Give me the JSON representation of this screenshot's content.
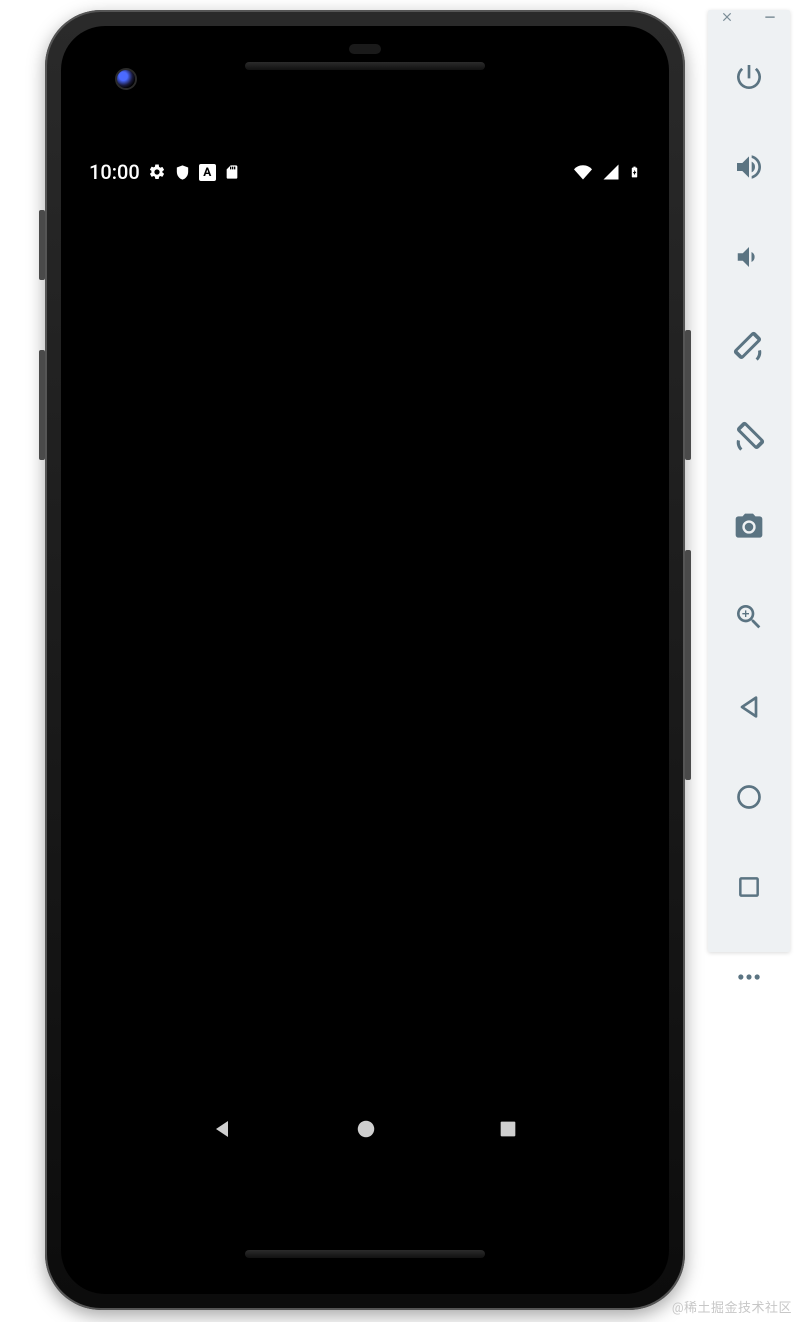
{
  "status_bar": {
    "time": "10:00",
    "left_icons": [
      "settings-icon",
      "shield-icon",
      "badge-a-icon",
      "sd-card-icon"
    ],
    "badge_a_letter": "A",
    "right_icons": [
      "wifi-icon",
      "cellular-icon",
      "battery-charging-icon"
    ]
  },
  "android_nav": {
    "buttons": [
      "back",
      "home",
      "overview"
    ]
  },
  "emulator_toolbar": {
    "window_controls": [
      "close",
      "minimize"
    ],
    "buttons": [
      "power",
      "volume-up",
      "volume-down",
      "rotate-left",
      "rotate-right",
      "screenshot",
      "zoom",
      "back",
      "home",
      "overview",
      "more"
    ]
  },
  "watermark": "@稀土掘金技术社区",
  "colors": {
    "toolbar_bg": "#eef1f3",
    "toolbar_icon": "#5b7482",
    "device_frame": "#1a1a1a",
    "screen_bg": "#000000",
    "status_icon": "#ffffff",
    "android_nav_icon": "#cfcfcf"
  }
}
